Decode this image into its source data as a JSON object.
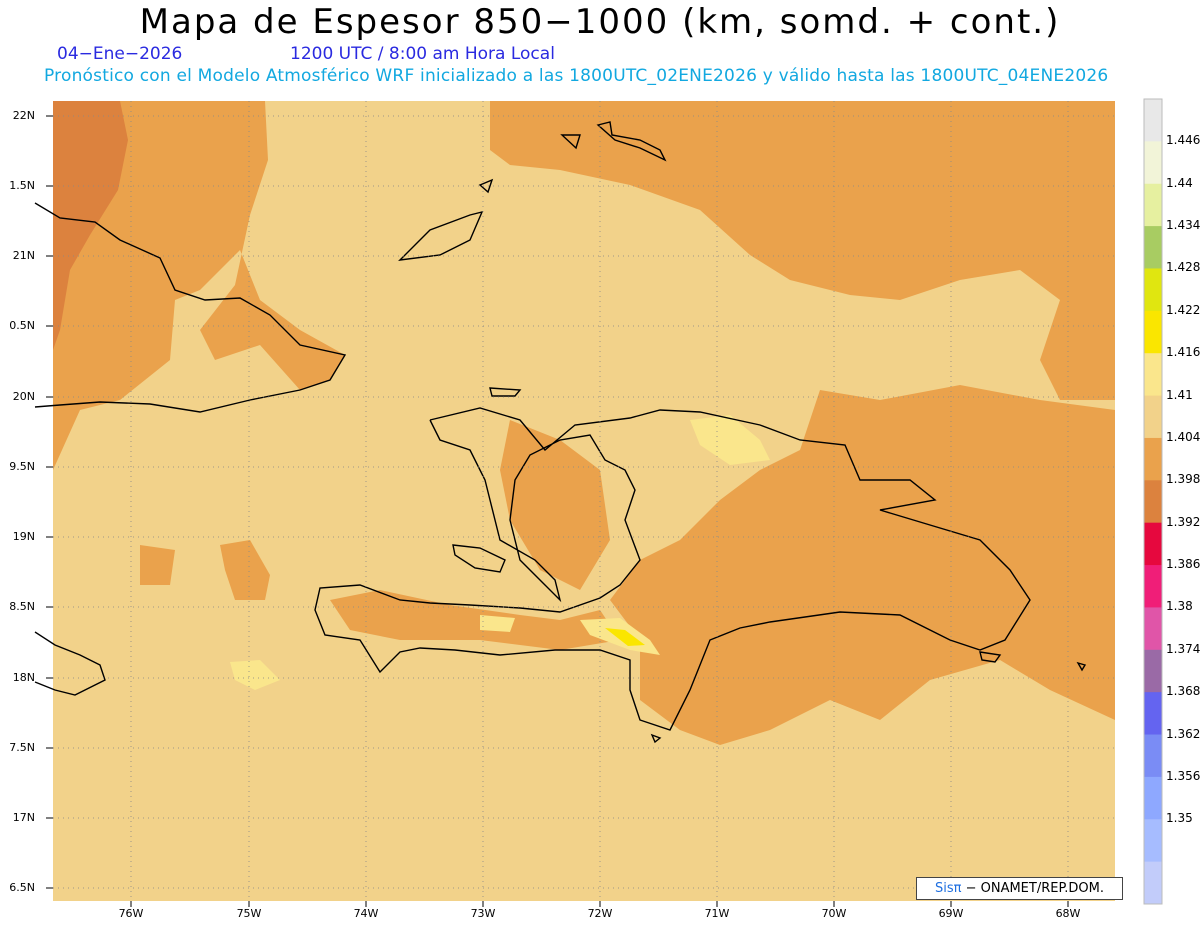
{
  "header": {
    "title": "Mapa de Espesor 850−1000 (km, somd. + cont.)",
    "date": "04−Ene−2026",
    "time": "1200 UTC / 8:00 am Hora Local",
    "model_line": "Pronóstico con el Modelo Atmosférico WRF inicializado a las 1800UTC_02ENE2026 y válido hasta las  1800UTC_04ENE2026"
  },
  "map": {
    "lat_labels": [
      "22N",
      "1.5N",
      "21N",
      "0.5N",
      "20N",
      "9.5N",
      "19N",
      "8.5N",
      "18N",
      "7.5N",
      "17N",
      "6.5N"
    ],
    "lon_labels": [
      "76W",
      "75W",
      "74W",
      "73W",
      "72W",
      "71W",
      "70W",
      "69W",
      "68W"
    ],
    "credit_prefix": "Sisπ",
    "credit_text": " − ONAMET/REP.DOM."
  },
  "colorbar": {
    "labels": [
      "1.446",
      "1.44",
      "1.434",
      "1.428",
      "1.422",
      "1.416",
      "1.41",
      "1.404",
      "1.398",
      "1.392",
      "1.386",
      "1.38",
      "1.374",
      "1.368",
      "1.362",
      "1.356",
      "1.35"
    ],
    "colors": [
      "#e8e8e8",
      "#f2f4d8",
      "#e6f0a0",
      "#a8cc62",
      "#e0e610",
      "#fae600",
      "#fae68c",
      "#f2d28a",
      "#eaa24c",
      "#dc823e",
      "#e6083e",
      "#f01e78",
      "#e055a8",
      "#9a6aa6",
      "#6464f0",
      "#7a8cf5",
      "#8ea8ff",
      "#a6bcff",
      "#c2ccfa"
    ]
  }
}
